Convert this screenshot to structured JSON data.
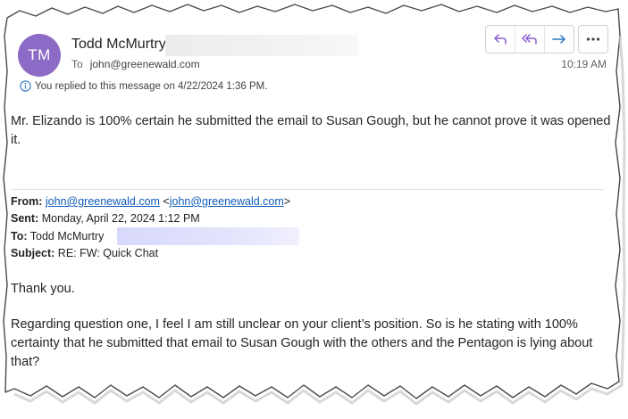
{
  "message": {
    "sender": {
      "initials": "TM",
      "name": "Todd McMurtry",
      "avatar_color": "#8c6bc6"
    },
    "to_label": "To",
    "to_address": "john@greenewald.com",
    "time": "10:19 AM",
    "info_text": "You replied to this message on 4/22/2024 1:36 PM.",
    "body": "Mr. Elizando is 100% certain he submitted the email to Susan Gough, but he cannot prove it was opened it."
  },
  "toolbar": {
    "reply_icon": "reply-icon",
    "reply_all_icon": "reply-all-icon",
    "forward_icon": "forward-icon",
    "more_icon": "more-icon",
    "accent": "#8a5cd0",
    "forward_color": "#2b78c5"
  },
  "quoted": {
    "from_label": "From:",
    "from_email": "john@greenewald.com",
    "from_email_bracket": "john@greenewald.com",
    "sent_label": "Sent:",
    "sent_value": "Monday, April 22, 2024 1:12 PM",
    "to_label": "To:",
    "to_value": "Todd McMurtry",
    "subject_label": "Subject:",
    "subject_value": "RE: FW: Quick Chat",
    "greeting": "Thank you.",
    "paragraph": "Regarding question one, I feel I am still unclear on your client’s position. So is he stating with 100% certainty that he submitted that email to Susan Gough with the others and the Pentagon is lying about that?"
  }
}
